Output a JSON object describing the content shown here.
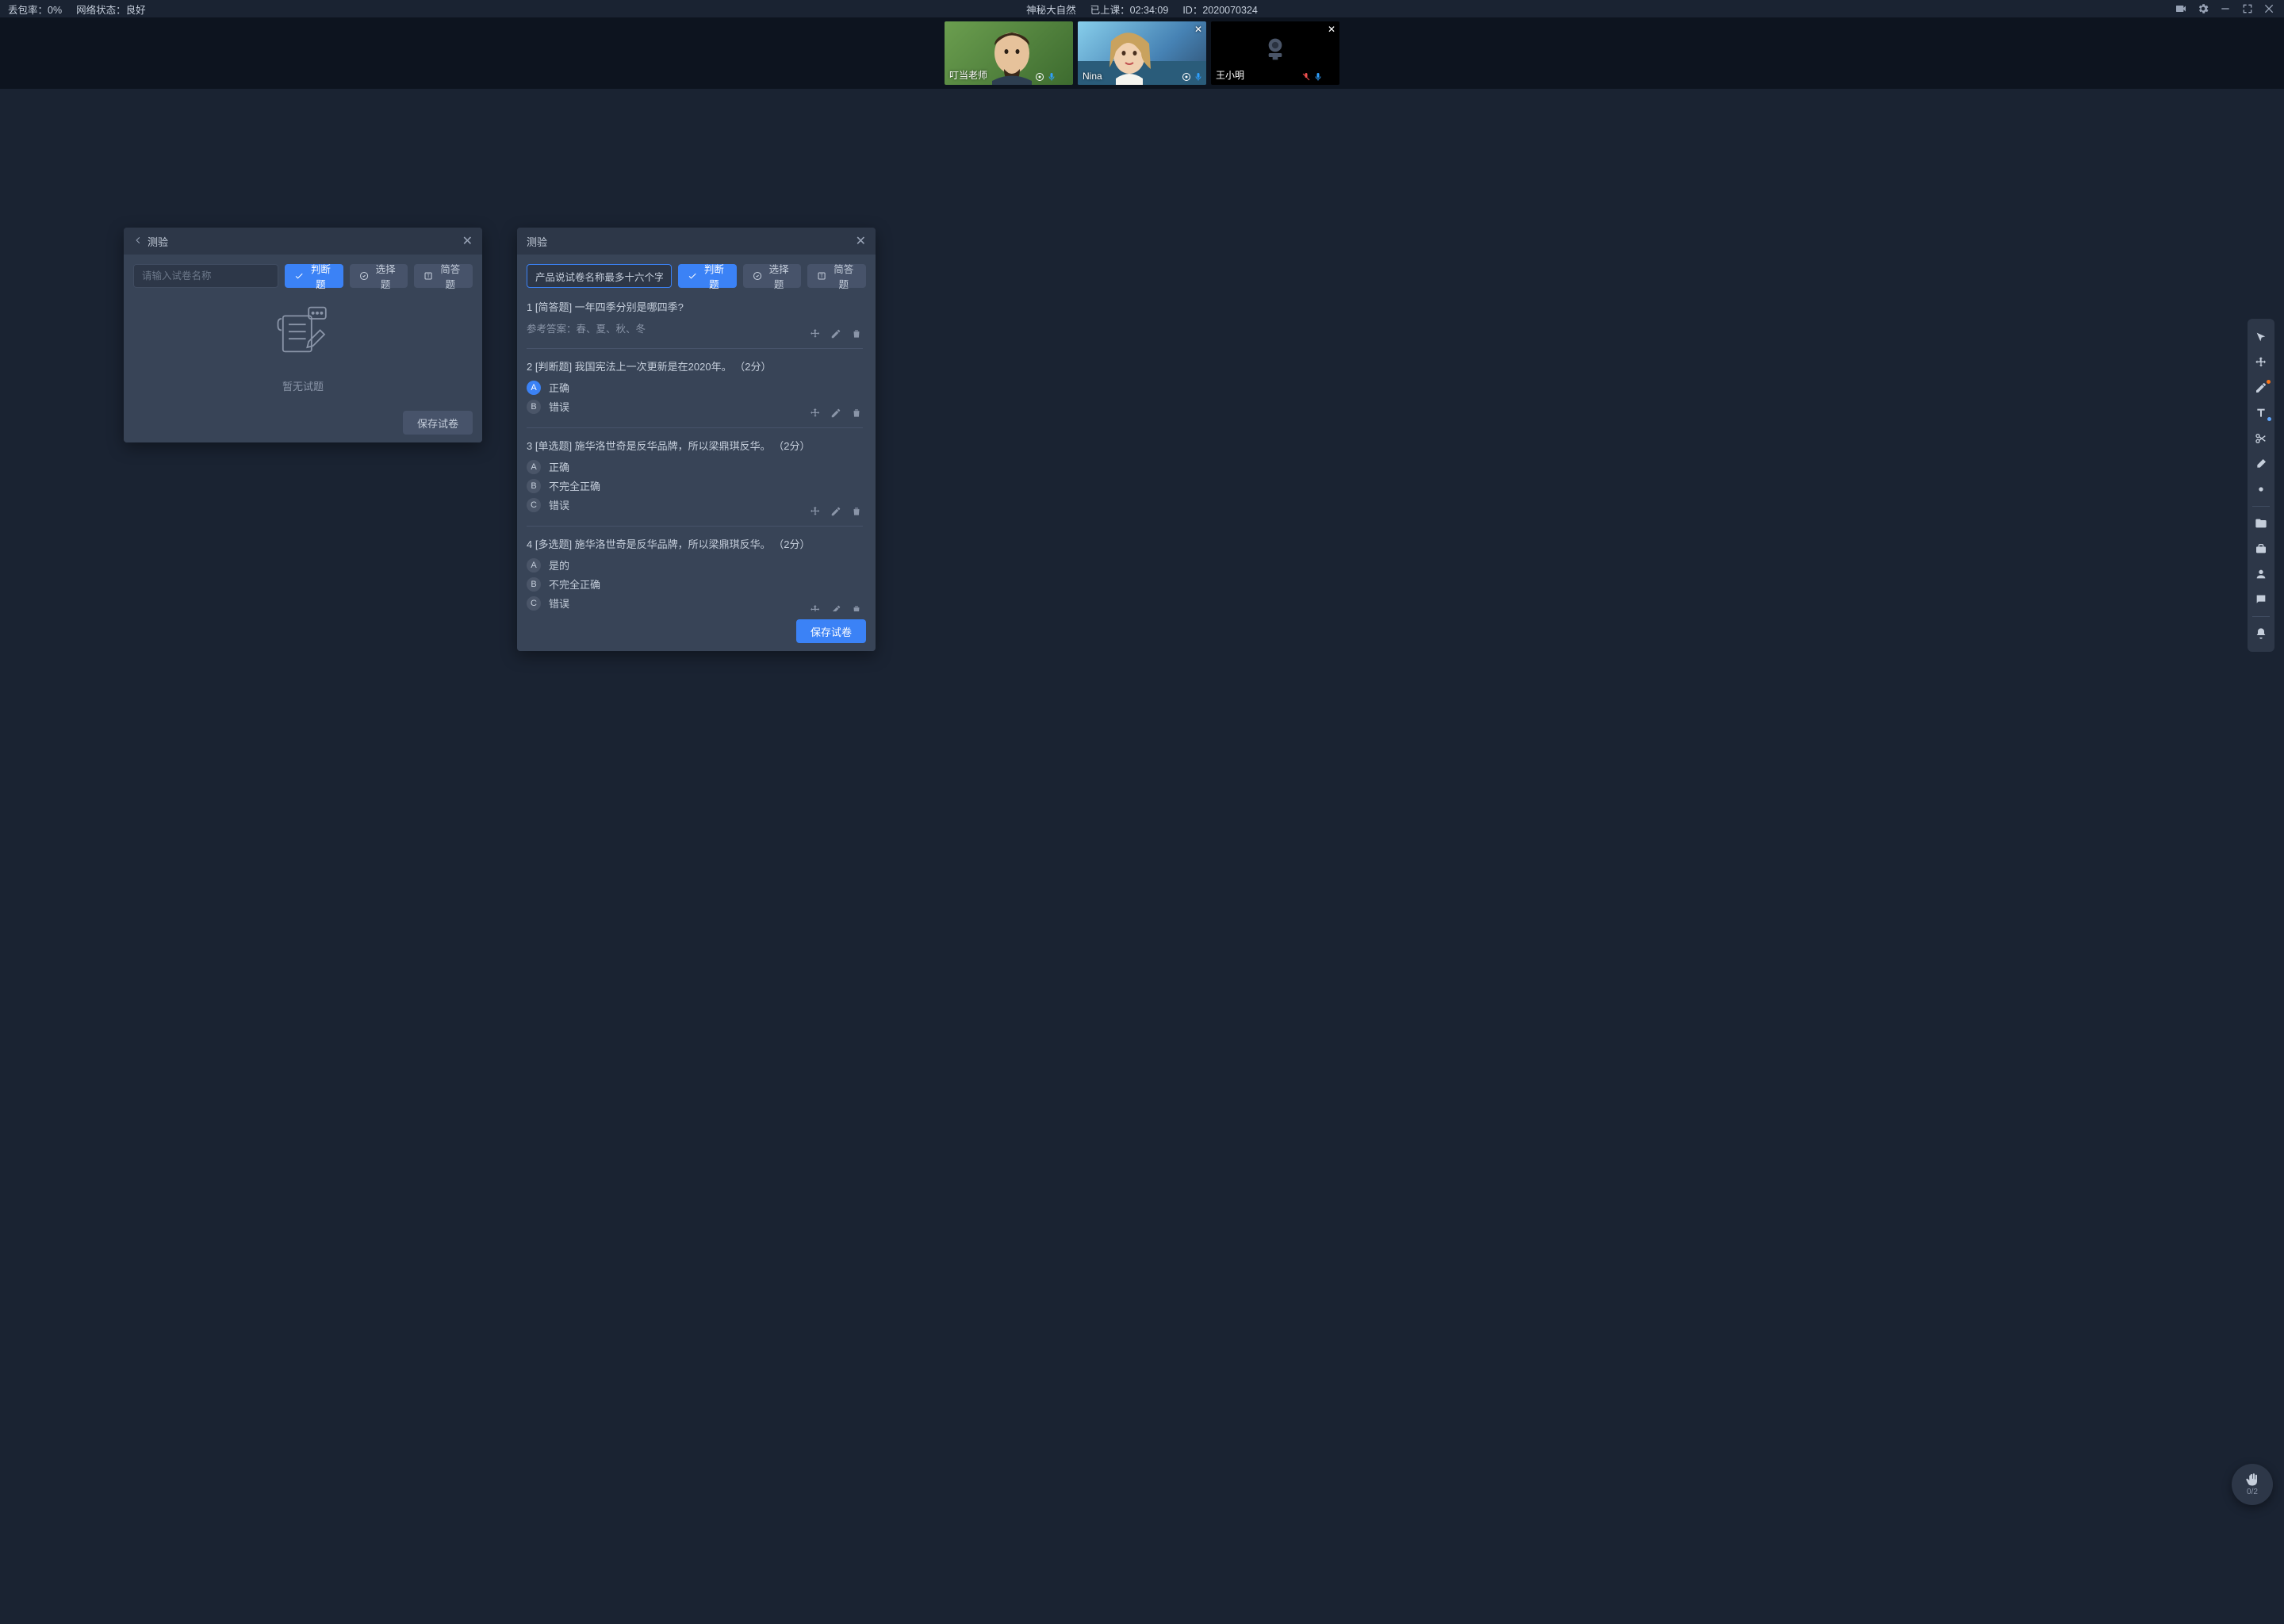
{
  "topbar": {
    "packet_loss_label": "丢包率：",
    "packet_loss_value": "0%",
    "network_label": "网络状态：",
    "network_value": "良好",
    "course_title": "神秘大自然",
    "elapsed_label": "已上课：",
    "elapsed_value": "02:34:09",
    "id_label": "ID：",
    "id_value": "2020070324"
  },
  "videos": [
    {
      "name": "叮当老师",
      "camera_on": true,
      "closable": false,
      "mic_on": true,
      "volume": true
    },
    {
      "name": "Nina",
      "camera_on": true,
      "closable": true,
      "mic_on": true,
      "volume": false
    },
    {
      "name": "王小明",
      "camera_on": false,
      "closable": true,
      "mic_on": false,
      "volume": true
    }
  ],
  "panel_left": {
    "title": "测验",
    "name_placeholder": "请输入试卷名称",
    "name_value": "",
    "btn_judge": "判断题",
    "btn_choice": "选择题",
    "btn_short": "简答题",
    "empty_text": "暂无试题",
    "save_label": "保存试卷"
  },
  "panel_right": {
    "title": "测验",
    "name_value": "产品说试卷名称最多十六个字",
    "btn_judge": "判断题",
    "btn_choice": "选择题",
    "btn_short": "简答题",
    "save_label": "保存试卷",
    "questions": [
      {
        "num": "1",
        "type_label": "[简答题]",
        "text": "一年四季分别是哪四季?",
        "points": "",
        "answer_label": "参考答案：",
        "answer": "春、夏、秋、冬",
        "options": []
      },
      {
        "num": "2",
        "type_label": "[判断题]",
        "text": "我国宪法上一次更新是在2020年。",
        "points": "（2分）",
        "options": [
          {
            "letter": "A",
            "text": "正确",
            "active": true
          },
          {
            "letter": "B",
            "text": "错误",
            "active": false
          }
        ]
      },
      {
        "num": "3",
        "type_label": "[单选题]",
        "text": "施华洛世奇是反华品牌，所以梁鼎琪反华。",
        "points": "（2分）",
        "options": [
          {
            "letter": "A",
            "text": "正确",
            "active": false
          },
          {
            "letter": "B",
            "text": "不完全正确",
            "active": false
          },
          {
            "letter": "C",
            "text": "错误",
            "active": false
          }
        ]
      },
      {
        "num": "4",
        "type_label": "[多选题]",
        "text": "施华洛世奇是反华品牌，所以梁鼎琪反华。",
        "points": "（2分）",
        "options": [
          {
            "letter": "A",
            "text": "是的",
            "active": false
          },
          {
            "letter": "B",
            "text": "不完全正确",
            "active": false
          },
          {
            "letter": "C",
            "text": "错误",
            "active": false
          }
        ]
      }
    ]
  },
  "hand": {
    "count": "0/2"
  },
  "toolbar_icons": [
    "cursor-icon",
    "move-icon",
    "pen-icon",
    "text-icon",
    "scissors-icon",
    "eraser-icon",
    "pointer-dot-icon",
    "folder-icon",
    "toolbox-icon",
    "user-icon",
    "chat-icon",
    "bell-icon"
  ]
}
